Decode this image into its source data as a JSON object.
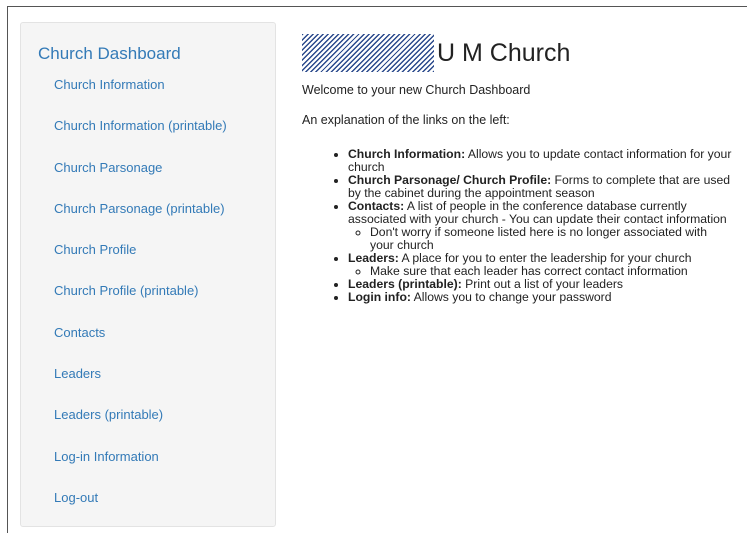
{
  "sidebar": {
    "title": "Church Dashboard",
    "items": [
      {
        "label": "Church Information"
      },
      {
        "label": "Church Information (printable)"
      },
      {
        "label": "Church Parsonage"
      },
      {
        "label": "Church Parsonage (printable)"
      },
      {
        "label": "Church Profile"
      },
      {
        "label": "Church Profile (printable)"
      },
      {
        "label": "Contacts"
      },
      {
        "label": "Leaders"
      },
      {
        "label": "Leaders (printable)"
      },
      {
        "label": "Log-in Information"
      },
      {
        "label": "Log-out"
      }
    ]
  },
  "header": {
    "church_name": "U M Church"
  },
  "main": {
    "welcome": "Welcome to your new Church Dashboard",
    "explanation": "An explanation of the links on the left:",
    "bullets": [
      {
        "term": "Church Information:",
        "text": " Allows you to update contact information for your church"
      },
      {
        "term": "Church Parsonage/ Church Profile:",
        "text": " Forms to complete that are used by the cabinet during the appointment season"
      },
      {
        "term": "Contacts:",
        "text": " A list of people in the conference database currently associated with your church - You can update their contact information",
        "sub": "Don't worry if someone listed here is no longer associated with your church"
      },
      {
        "term": "Leaders:",
        "text": " A place for you to enter the leadership for your church",
        "sub": "Make sure that each leader has correct contact information"
      },
      {
        "term": "Leaders (printable):",
        "text": " Print out a list of your leaders"
      },
      {
        "term": "Login info:",
        "text": " Allows you to change your password"
      }
    ]
  },
  "colors": {
    "link": "#337ab7",
    "sidebar_bg": "#f5f5f5",
    "logo_pattern": "#2b4a8c"
  }
}
